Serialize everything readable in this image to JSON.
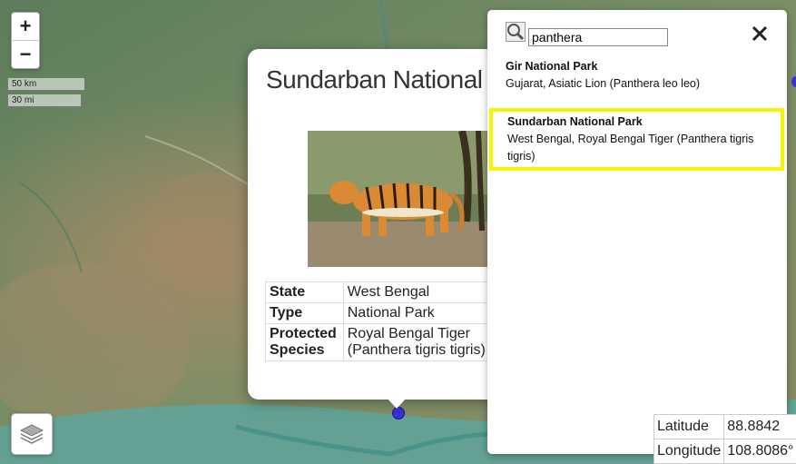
{
  "map": {
    "zoom_in_label": "+",
    "zoom_out_label": "−",
    "scale_km": "50 km",
    "scale_mi": "30 mi",
    "layers_icon": "layers-icon",
    "colors": {
      "land": "#6f8f6a",
      "water": "#4fa8a0",
      "marker": "#3a2fd9"
    }
  },
  "popup": {
    "title": "Sundarban National Park",
    "image_alt": "Royal Bengal Tiger",
    "rows": [
      {
        "key": "State",
        "value": "West Bengal"
      },
      {
        "key": "Type",
        "value": "National Park"
      },
      {
        "key": "Protected Species",
        "key_line1": "Protected",
        "key_line2": "Species",
        "value_line1": "Royal Bengal Tiger",
        "value_line2": "(Panthera tigris tigris)"
      }
    ]
  },
  "search": {
    "query": "panthera",
    "search_icon": "search-icon",
    "close_icon": "close-icon",
    "results": [
      {
        "name": "Gir National Park",
        "detail": "Gujarat, Asiatic Lion (Panthera leo leo)",
        "selected": false
      },
      {
        "name": "Sundarban National Park",
        "detail": "West Bengal, Royal Bengal Tiger (Panthera tigris tigris)",
        "selected": true
      }
    ],
    "highlight_color": "#f5f500"
  },
  "coordinates": {
    "lat_label": "Latitude",
    "lat_value": "88.8842",
    "lon_label": "Longitude",
    "lon_value": "108.8086°"
  }
}
